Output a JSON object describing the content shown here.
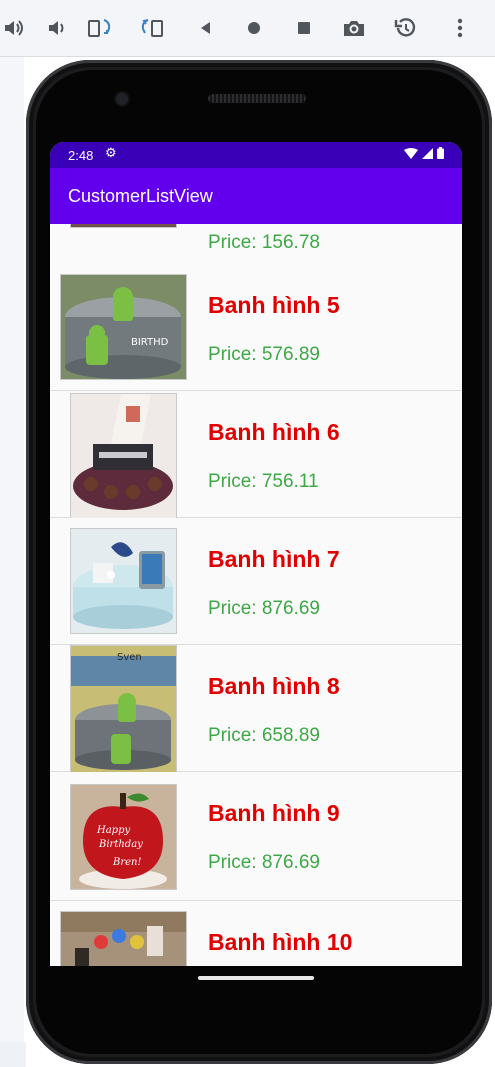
{
  "emulator_toolbar": {
    "buttons": [
      {
        "name": "volume-up-icon",
        "glyph": "🔊"
      },
      {
        "name": "volume-down-icon",
        "glyph": "🔉"
      },
      {
        "name": "rotate-left-icon",
        "glyph": "⟲"
      },
      {
        "name": "rotate-right-icon",
        "glyph": "⟳"
      },
      {
        "name": "back-icon",
        "glyph": "◀"
      },
      {
        "name": "home-icon",
        "glyph": "●"
      },
      {
        "name": "overview-icon",
        "glyph": "■"
      },
      {
        "name": "camera-icon",
        "glyph": "📷"
      },
      {
        "name": "snapshot-restore-icon",
        "glyph": "↺"
      },
      {
        "name": "more-options-icon",
        "glyph": "⋮"
      }
    ]
  },
  "status_bar": {
    "time": "2:48",
    "background": "#3a00b8"
  },
  "app_bar": {
    "title": "CustomerListView",
    "background": "#6200ee"
  },
  "list": {
    "name_color": "#e00000",
    "price_color": "#3da845",
    "items": [
      {
        "name": "",
        "price": "Price: 156.78"
      },
      {
        "name": "Banh hình 5",
        "price": "Price: 576.89"
      },
      {
        "name": "Banh hình 6",
        "price": "Price: 756.11"
      },
      {
        "name": "Banh hình 7",
        "price": "Price: 876.69"
      },
      {
        "name": "Banh hình 8",
        "price": "Price: 658.89"
      },
      {
        "name": "Banh hình 9",
        "price": "Price: 876.69"
      },
      {
        "name": "Banh hình 10",
        "price": ""
      }
    ]
  }
}
